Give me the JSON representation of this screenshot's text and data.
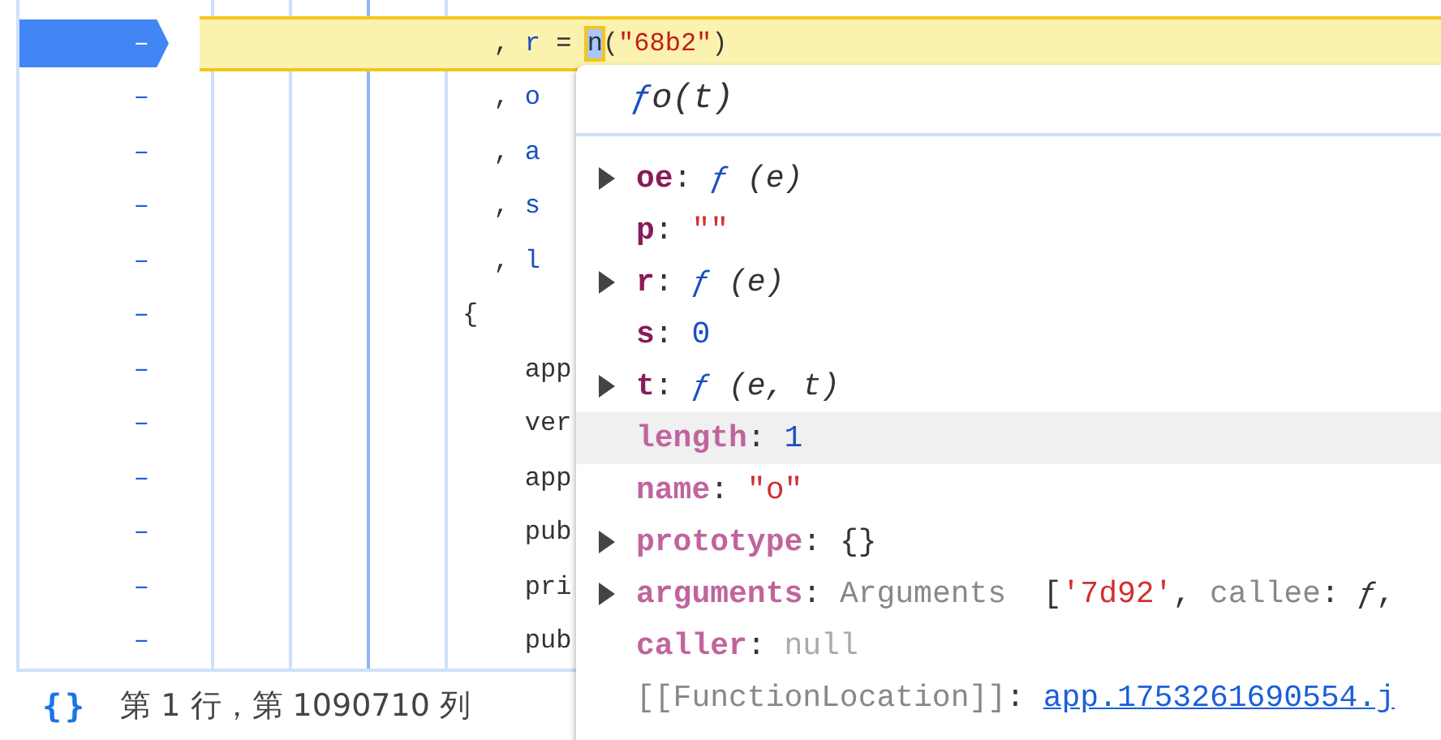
{
  "editor": {
    "lines": [
      {
        "gutter": "–",
        "breakpoint": true,
        "highlighted": true,
        "code": [
          {
            "text": "  , ",
            "kind": "punct"
          },
          {
            "text": "r",
            "kind": "var"
          },
          {
            "text": " = ",
            "kind": "punct"
          },
          {
            "text": "n",
            "kind": "hovered"
          },
          {
            "text": "(",
            "kind": "punct"
          },
          {
            "text": "\"68b2\"",
            "kind": "string"
          },
          {
            "text": ")",
            "kind": "punct"
          }
        ]
      },
      {
        "gutter": "–",
        "breakpoint": false,
        "highlighted": false,
        "code": [
          {
            "text": "  , ",
            "kind": "punct"
          },
          {
            "text": "o",
            "kind": "var"
          }
        ]
      },
      {
        "gutter": "–",
        "breakpoint": false,
        "highlighted": false,
        "code": [
          {
            "text": "  , ",
            "kind": "punct"
          },
          {
            "text": "a",
            "kind": "var"
          }
        ]
      },
      {
        "gutter": "–",
        "breakpoint": false,
        "highlighted": false,
        "code": [
          {
            "text": "  , ",
            "kind": "punct"
          },
          {
            "text": "s",
            "kind": "var"
          }
        ]
      },
      {
        "gutter": "–",
        "breakpoint": false,
        "highlighted": false,
        "code": [
          {
            "text": "  , ",
            "kind": "punct"
          },
          {
            "text": "l",
            "kind": "var"
          }
        ]
      },
      {
        "gutter": "–",
        "breakpoint": false,
        "highlighted": false,
        "code": [
          {
            "text": "{",
            "kind": "punct"
          }
        ]
      },
      {
        "gutter": "–",
        "breakpoint": false,
        "highlighted": false,
        "code": [
          {
            "text": "    app",
            "kind": "punct"
          }
        ]
      },
      {
        "gutter": "–",
        "breakpoint": false,
        "highlighted": false,
        "code": [
          {
            "text": "    ver",
            "kind": "punct"
          }
        ]
      },
      {
        "gutter": "–",
        "breakpoint": false,
        "highlighted": false,
        "code": [
          {
            "text": "    app",
            "kind": "punct"
          }
        ]
      },
      {
        "gutter": "–",
        "breakpoint": false,
        "highlighted": false,
        "code": [
          {
            "text": "    pub",
            "kind": "punct"
          }
        ]
      },
      {
        "gutter": "–",
        "breakpoint": false,
        "highlighted": false,
        "code": [
          {
            "text": "    pri",
            "kind": "punct"
          }
        ]
      },
      {
        "gutter": "–",
        "breakpoint": false,
        "highlighted": false,
        "code": [
          {
            "text": "    pub",
            "kind": "punct"
          }
        ]
      }
    ]
  },
  "status_bar": {
    "icon_text": "{}",
    "position": "第 1 行，第 1090710 列"
  },
  "popup": {
    "title": [
      {
        "text": "ƒ",
        "kind": "keyword"
      },
      {
        "text": " o(t)",
        "kind": "params"
      }
    ],
    "properties": [
      {
        "key": "oe",
        "kind": "own",
        "expandable": true,
        "hovered": false,
        "value": [
          {
            "text": ": ",
            "kind": "punct"
          },
          {
            "text": "ƒ",
            "kind": "keyword"
          },
          {
            "text": " (e)",
            "kind": "params"
          }
        ]
      },
      {
        "key": "p",
        "kind": "own",
        "expandable": false,
        "hovered": false,
        "value": [
          {
            "text": ": ",
            "kind": "punct"
          },
          {
            "text": "\"\"",
            "kind": "string"
          }
        ]
      },
      {
        "key": "r",
        "kind": "own",
        "expandable": true,
        "hovered": false,
        "value": [
          {
            "text": ": ",
            "kind": "punct"
          },
          {
            "text": "ƒ",
            "kind": "keyword"
          },
          {
            "text": " (e)",
            "kind": "params"
          }
        ]
      },
      {
        "key": "s",
        "kind": "own",
        "expandable": false,
        "hovered": false,
        "value": [
          {
            "text": ": ",
            "kind": "punct"
          },
          {
            "text": "0",
            "kind": "number"
          }
        ]
      },
      {
        "key": "t",
        "kind": "own",
        "expandable": true,
        "hovered": false,
        "value": [
          {
            "text": ": ",
            "kind": "punct"
          },
          {
            "text": "ƒ",
            "kind": "keyword"
          },
          {
            "text": " (e, t)",
            "kind": "params"
          }
        ]
      },
      {
        "key": "length",
        "kind": "builtin",
        "expandable": false,
        "hovered": true,
        "value": [
          {
            "text": ": ",
            "kind": "punct"
          },
          {
            "text": "1",
            "kind": "number"
          }
        ]
      },
      {
        "key": "name",
        "kind": "builtin",
        "expandable": false,
        "hovered": false,
        "value": [
          {
            "text": ": ",
            "kind": "punct"
          },
          {
            "text": "\"o\"",
            "kind": "string"
          }
        ]
      },
      {
        "key": "prototype",
        "kind": "builtin",
        "expandable": true,
        "hovered": false,
        "value": [
          {
            "text": ": ",
            "kind": "punct"
          },
          {
            "text": "{}",
            "kind": "punct"
          }
        ]
      },
      {
        "key": "arguments",
        "kind": "builtin",
        "expandable": true,
        "hovered": false,
        "value": [
          {
            "text": ": ",
            "kind": "punct"
          },
          {
            "text": "Arguments",
            "kind": "plain"
          },
          {
            "text": "  [",
            "kind": "punct"
          },
          {
            "text": "'7d92'",
            "kind": "string"
          },
          {
            "text": ", ",
            "kind": "punct"
          },
          {
            "text": "callee",
            "kind": "plain"
          },
          {
            "text": ": ",
            "kind": "punct"
          },
          {
            "text": "ƒ",
            "kind": "params"
          },
          {
            "text": ",",
            "kind": "punct"
          }
        ]
      },
      {
        "key": "caller",
        "kind": "builtin",
        "expandable": false,
        "hovered": false,
        "value": [
          {
            "text": ": ",
            "kind": "punct"
          },
          {
            "text": "null",
            "kind": "null"
          }
        ]
      },
      {
        "key": "[[FunctionLocation]]",
        "kind": "internal",
        "expandable": false,
        "hovered": false,
        "value": [
          {
            "text": ": ",
            "kind": "punct"
          },
          {
            "text": "app.1753261690554.j",
            "kind": "link"
          }
        ]
      }
    ]
  }
}
